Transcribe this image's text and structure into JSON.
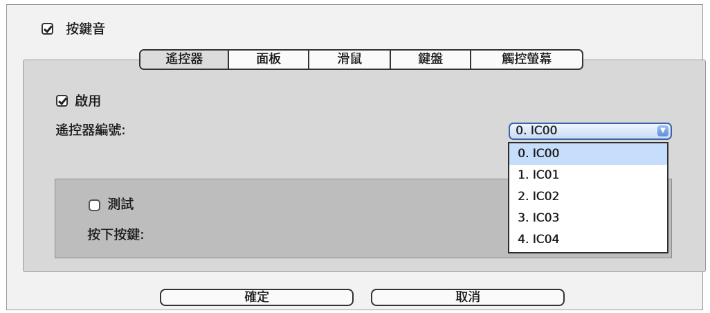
{
  "keytone": {
    "label": "按鍵音",
    "checked": true
  },
  "tabs": [
    {
      "label": "遙控器",
      "active": true
    },
    {
      "label": "面板",
      "active": false
    },
    {
      "label": "滑鼠",
      "active": false
    },
    {
      "label": "鍵盤",
      "active": false
    },
    {
      "label": "觸控螢幕",
      "active": false
    }
  ],
  "remote": {
    "enable": {
      "label": "啟用",
      "checked": true
    },
    "id_label": "遙控器編號:",
    "select": {
      "value": "0. IC00",
      "options": [
        "0. IC00",
        "1. IC01",
        "2. IC02",
        "3. IC03",
        "4. IC04"
      ]
    }
  },
  "test": {
    "label": "測試",
    "checked": false,
    "press_label": "按下按鍵:"
  },
  "buttons": {
    "ok": "確定",
    "cancel": "取消"
  },
  "colors": {
    "accent": "#3e63a8",
    "highlight": "#c6ddfb",
    "panel": "#d8d8d8",
    "test_panel": "#bdbdbd"
  }
}
